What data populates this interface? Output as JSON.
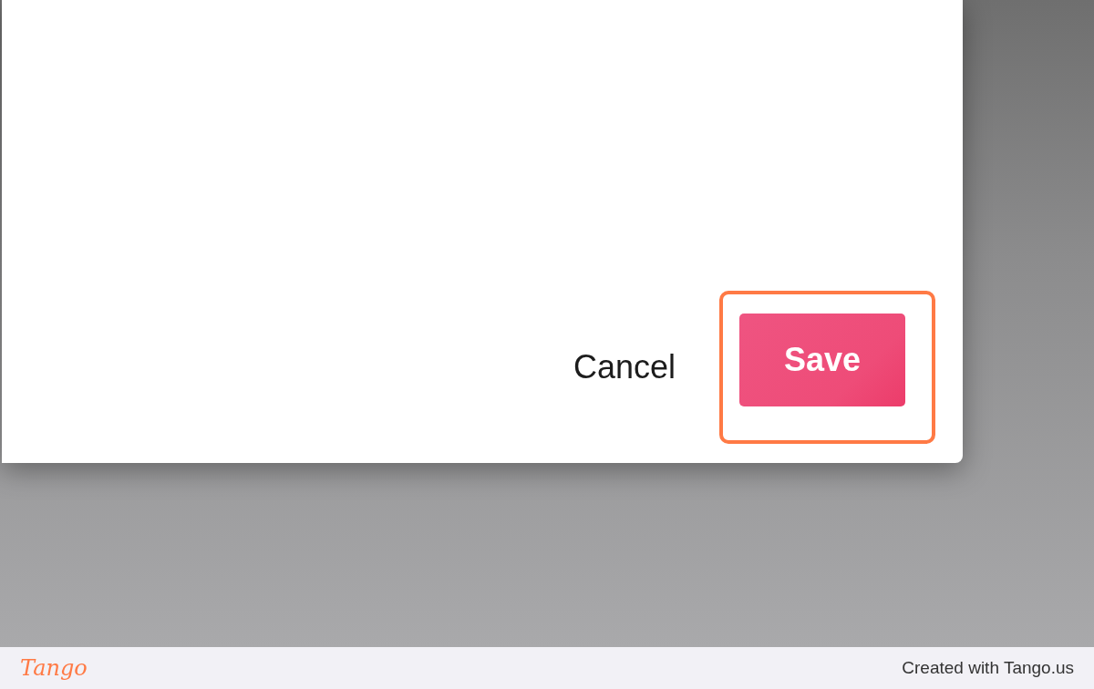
{
  "dialog": {
    "buttons": [
      {
        "kind": "text",
        "label": "Cancel",
        "highlighted": false
      },
      {
        "kind": "primary",
        "label": "Save",
        "highlighted": true
      }
    ]
  },
  "footer": {
    "logo": "Tango",
    "credit": "Created with Tango.us"
  }
}
